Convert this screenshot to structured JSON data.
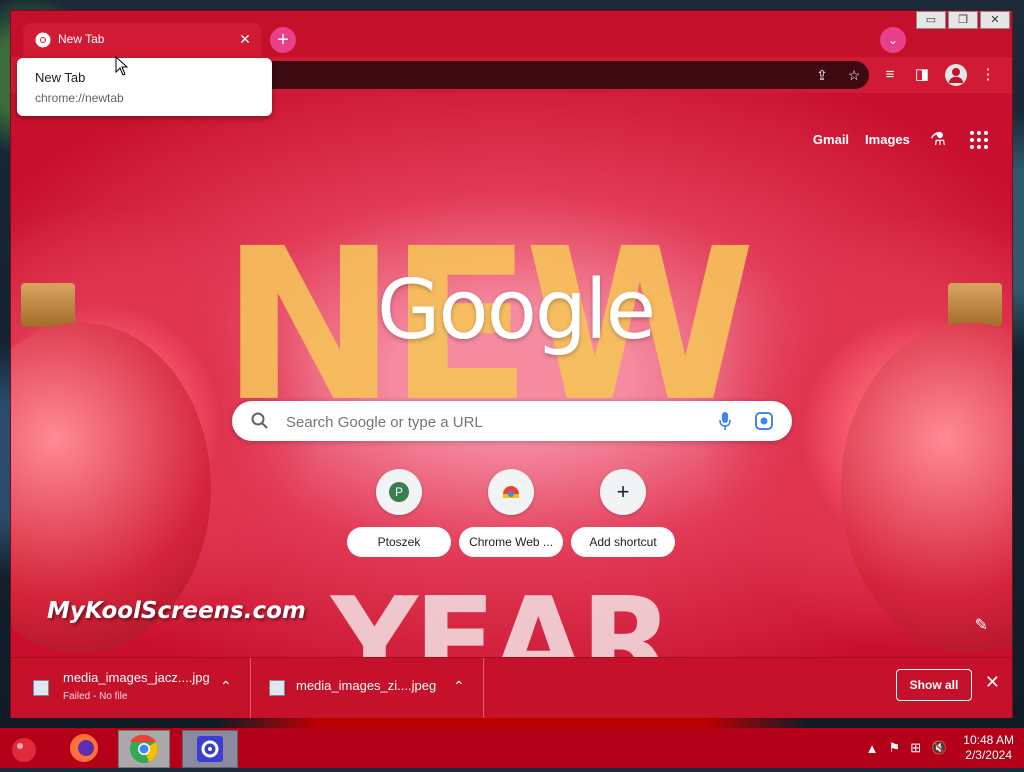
{
  "browser": {
    "tab": {
      "title": "New Tab"
    },
    "tooltip": {
      "title": "New Tab",
      "url": "chrome://newtab"
    },
    "window_buttons": {
      "minimize": "▭",
      "restore": "❐",
      "close": "✕"
    }
  },
  "newtab": {
    "links": {
      "gmail": "Gmail",
      "images": "Images"
    },
    "logo": "Google",
    "search": {
      "placeholder": "Search Google or type a URL"
    },
    "shortcuts": [
      {
        "label": "Ptoszek",
        "initial": "P"
      },
      {
        "label": "Chrome Web ..."
      },
      {
        "label": "Add shortcut"
      }
    ],
    "watermark": "MyKoolScreens.com",
    "background_letters": {
      "new": "NEW",
      "year": "YEAR"
    }
  },
  "downloads": {
    "items": [
      {
        "filename": "media_images_jacz....jpg",
        "status": "Failed - No file"
      },
      {
        "filename": "media_images_zi....jpeg"
      }
    ],
    "show_all": "Show all"
  },
  "taskbar": {
    "time": "10:48 AM",
    "date": "2/3/2024"
  },
  "colors": {
    "accent": "#c5112a",
    "tab_active": "#d11a33",
    "pink_button": "#e8408a"
  }
}
